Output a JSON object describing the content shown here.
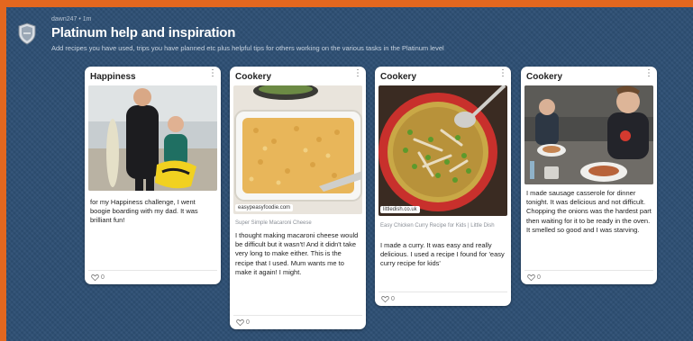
{
  "post": {
    "author": "dawn247",
    "time": "1m",
    "title": "Platinum help and inspiration",
    "description": "Add recipes you have used, trips you have planned etc plus helpful tips for others working on the various tasks in the Platinum level"
  },
  "cards": [
    {
      "column": "Happiness",
      "text": "for my Happiness challenge, I went boogie boarding with my dad. It was brilliant fun!",
      "likes": "0"
    },
    {
      "column": "Cookery",
      "source": "easypeasyfoodie.com",
      "link_title": "Super Simple Macaroni Cheese",
      "text": "I thought making macaroni cheese would be difficult but it wasn't! And it didn't take very long to make either. This is the recipe that I used. Mum wants me to make it again! I might.",
      "likes": "0"
    },
    {
      "column": "Cookery",
      "source": "littledish.co.uk",
      "link_title": "Easy Chicken Curry Recipe for Kids | Little Dish",
      "text": "I made a curry. It was easy and really delicious. I used a recipe I found for 'easy curry recipe for kids'",
      "likes": "0"
    },
    {
      "column": "Cookery",
      "text": "I made sausage casserole for dinner tonight. It was delicious and not difficult. Chopping the onions was the hardest part then waiting for it to be ready in the oven. It smelled so good and I was starving.",
      "likes": "0"
    }
  ],
  "colors": {
    "frame": "#e3671f",
    "board": "#2d4f74",
    "card": "#ffffff"
  },
  "icons": {
    "avatar": "shield-crest-icon",
    "menu": "vertical-dots-icon",
    "like": "heart-outline-icon"
  }
}
